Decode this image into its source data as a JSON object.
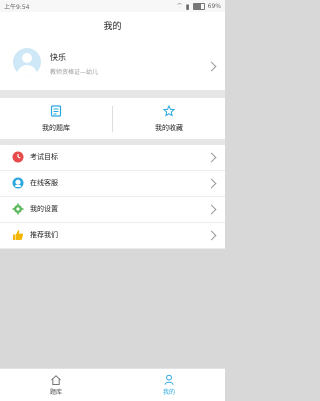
{
  "status": {
    "time": "上午9:54",
    "battery": "69%"
  },
  "header": {
    "title": "我的"
  },
  "profile": {
    "name": "快乐",
    "subtitle": "教师资格证—幼儿"
  },
  "quick_actions": [
    {
      "label": "我的题库",
      "icon": "question-bank-icon"
    },
    {
      "label": "我的收藏",
      "icon": "star-icon"
    }
  ],
  "menu": [
    {
      "label": "考试目标",
      "icon": "clock-icon",
      "color": "#e84b4b"
    },
    {
      "label": "在线客服",
      "icon": "customer-service-icon",
      "color": "#2aa7e0"
    },
    {
      "label": "我的设置",
      "icon": "gear-icon",
      "color": "#5cb85c"
    },
    {
      "label": "推荐我们",
      "icon": "thumbs-up-icon",
      "color": "#f2b705"
    }
  ],
  "tabs": [
    {
      "label": "题库",
      "icon": "home-icon",
      "active": false
    },
    {
      "label": "我的",
      "icon": "profile-icon",
      "active": true
    }
  ],
  "colors": {
    "accent": "#2aa7e0",
    "background": "#d8d8d8"
  }
}
